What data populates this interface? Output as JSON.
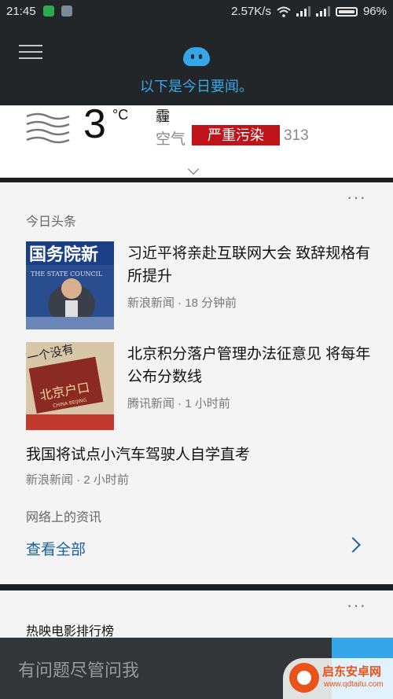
{
  "status_bar": {
    "time": "21:45",
    "speed": "2.57K/s",
    "battery": "96%"
  },
  "header": {
    "message": "以下是今日要闻。"
  },
  "weather": {
    "temp": "3",
    "unit": "°C",
    "condition": "霾",
    "air_label": "空气",
    "air_quality": "严重污染",
    "aqi": "313",
    "air_badge_color": "#c0141b"
  },
  "news": {
    "section_title": "今日头条",
    "items": [
      {
        "title": "习近平将亲赴互联网大会 致辞规格有所提升",
        "source": "新浪新闻 · 18 分钟前",
        "thumb_text": "国务院新",
        "thumb_sub": "THE STATE COUNCIL"
      },
      {
        "title": "北京积分落户管理办法征意见 将每年公布分数线",
        "source": "腾讯新闻 · 1 小时前",
        "thumb_text": "北京户口",
        "thumb_sub": "CHINA BEIJING",
        "thumb_top": "一个没有"
      },
      {
        "title": "我国将试点小汽车驾驶人自学直考",
        "source": "新浪新闻 · 2 小时前"
      }
    ],
    "web_title": "网络上的资讯",
    "see_all": "查看全部"
  },
  "movies": {
    "title": "热映电影排行榜"
  },
  "bottom": {
    "ask_placeholder": "有问题尽管问我"
  },
  "watermark": {
    "name": "启东安卓网",
    "url": "www.qdtaitu.com"
  },
  "colors": {
    "accent": "#35a7e8",
    "link": "#1a5fa0"
  }
}
